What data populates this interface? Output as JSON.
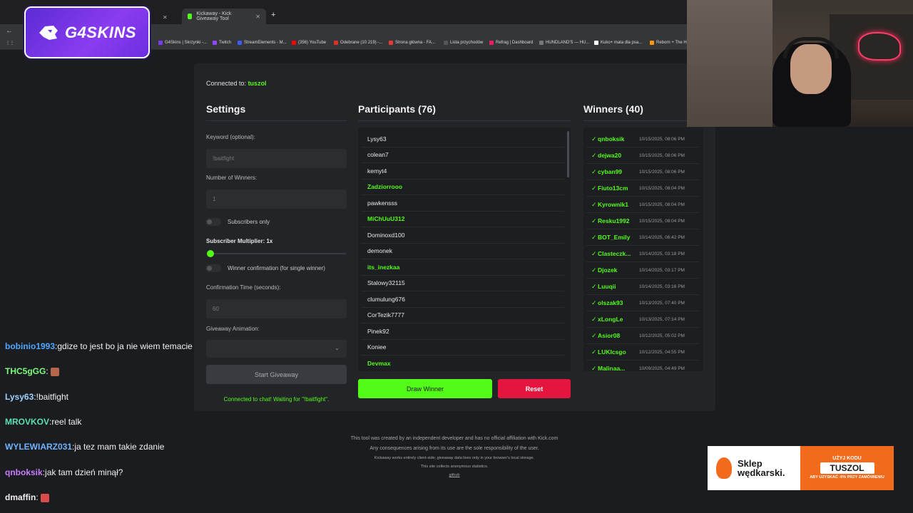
{
  "browser": {
    "tabs": [
      {
        "label": "Kickaway - Kick Giveaway Tool",
        "active": true
      }
    ],
    "bookmarks": [
      {
        "label": "G4Skins | Skrzynki -...",
        "color": "#7b3cf0"
      },
      {
        "label": "Twitch",
        "color": "#9146ff"
      },
      {
        "label": "StreamElements - M...",
        "color": "#3d5afe"
      },
      {
        "label": "(356) YouTube",
        "color": "#ff0000"
      },
      {
        "label": "Odebrane (10 219) -...",
        "color": "#d93025"
      },
      {
        "label": "Strona główna - FA...",
        "color": "#e53935"
      },
      {
        "label": "Lista przychodów",
        "color": "#555555"
      },
      {
        "label": "Refrag | Dashboard",
        "color": "#e91e63"
      },
      {
        "label": "HUNDLAND'S — HU...",
        "color": "#777777"
      },
      {
        "label": "Kuko+ mata dla psa...",
        "color": "#ffffff"
      },
      {
        "label": "Reborn + The Ho",
        "color": "#ff9800"
      }
    ]
  },
  "logo": {
    "text": "G4SKINS"
  },
  "app": {
    "connected_prefix": "Connected to:",
    "connected_channel": "tuszol",
    "settings": {
      "title": "Settings",
      "keyword_label": "Keyword (optional):",
      "keyword_placeholder": "!baitfight",
      "winners_label": "Number of Winners:",
      "winners_value": "1",
      "subscribers_only": "Subscribers only",
      "multiplier_label": "Subscriber Multiplier: 1x",
      "winner_confirmation": "Winner confirmation (for single winner)",
      "confirm_time_label": "Confirmation Time (seconds):",
      "confirm_time_value": "60",
      "animation_label": "Giveaway Animation:",
      "start_button": "Start Giveaway",
      "status": "Connected to chat! Waiting for \"!baitfight\"."
    },
    "participants": {
      "title": "Participants (76)",
      "items": [
        {
          "name": "Lysy63",
          "sub": false
        },
        {
          "name": "colean7",
          "sub": false
        },
        {
          "name": "kemyt4",
          "sub": false
        },
        {
          "name": "Zadziorrooo",
          "sub": true
        },
        {
          "name": "pawkensss",
          "sub": false
        },
        {
          "name": "MiChUuU312",
          "sub": true
        },
        {
          "name": "Dominoxd100",
          "sub": false
        },
        {
          "name": "demonek",
          "sub": false
        },
        {
          "name": "its_inezkaa",
          "sub": true
        },
        {
          "name": "Stalowy32115",
          "sub": false
        },
        {
          "name": "clumulung676",
          "sub": false
        },
        {
          "name": "CorTezik7777",
          "sub": false
        },
        {
          "name": "Pinek92",
          "sub": false
        },
        {
          "name": "Koniee",
          "sub": false
        },
        {
          "name": "Devmax",
          "sub": true
        }
      ],
      "draw_button": "Draw Winner",
      "reset_button": "Reset"
    },
    "winners": {
      "title": "Winners (40)",
      "check": "✓",
      "items": [
        {
          "name": "qnboksik",
          "time": "10/15/2025, 08:06 PM"
        },
        {
          "name": "dejwa20",
          "time": "10/15/2025, 08:06 PM"
        },
        {
          "name": "cyban99",
          "time": "10/15/2025, 08:06 PM"
        },
        {
          "name": "Fiuto13cm",
          "time": "10/15/2025, 08:04 PM"
        },
        {
          "name": "Kyrownik1",
          "time": "10/15/2025, 08:04 PM"
        },
        {
          "name": "Resku1992",
          "time": "10/15/2025, 08:04 PM"
        },
        {
          "name": "BOT_Emily",
          "time": "10/14/2025, 06:42 PM"
        },
        {
          "name": "Clasteczk...",
          "time": "10/14/2025, 03:18 PM"
        },
        {
          "name": "Djozek",
          "time": "10/14/2025, 03:17 PM"
        },
        {
          "name": "Luuqii",
          "time": "10/14/2025, 03:16 PM"
        },
        {
          "name": "olszak93",
          "time": "10/13/2025, 07:40 PM"
        },
        {
          "name": "xLongLe",
          "time": "10/13/2025, 07:14 PM"
        },
        {
          "name": "Asior08",
          "time": "10/12/2025, 05:02 PM"
        },
        {
          "name": "LUKIcsgo",
          "time": "10/12/2025, 04:55 PM"
        },
        {
          "name": "Malinaa...",
          "time": "10/09/2025, 04:49 PM"
        }
      ]
    },
    "footer": {
      "line1": "This tool was created by an independent developer and has no official affiliation with Kick.com",
      "line2": "Any consequences arising from its use are the sole responsibility of the user.",
      "line3": "Kickaway works entirely client-side; giveaway data lives only in your browser's local storage.",
      "line4": "This site collects anonymous statistics.",
      "link": "github"
    }
  },
  "chat": [
    {
      "user": "bobinio1993",
      "color": "#4ea8ff",
      "message": "gdize to jest bo ja nie wiem temacie"
    },
    {
      "user": "THC5gGG",
      "color": "#7cfc7c",
      "message": ""
    },
    {
      "user": "Lysy63",
      "color": "#9fd3ff",
      "message": "!baitfight"
    },
    {
      "user": "MROVKOV",
      "color": "#5ee0b0",
      "message": "reel talk"
    },
    {
      "user": "WYLEWIARZ031",
      "color": "#6fb3ff",
      "message": "ja tez mam takie zdanie"
    },
    {
      "user": "qnboksik",
      "color": "#c77dff",
      "message": "jak tam dzień minął?"
    },
    {
      "user": "dmaffin",
      "color": "#f0f0f0",
      "message": ""
    }
  ],
  "ad": {
    "brand_line1": "Sklep",
    "brand_line2": "wędkarski.",
    "use_code": "UŻYJ KODU",
    "code": "TUSZOL",
    "note": "ABY UZYSKAĆ -5% PRZY ZAMÓWIENIU"
  }
}
